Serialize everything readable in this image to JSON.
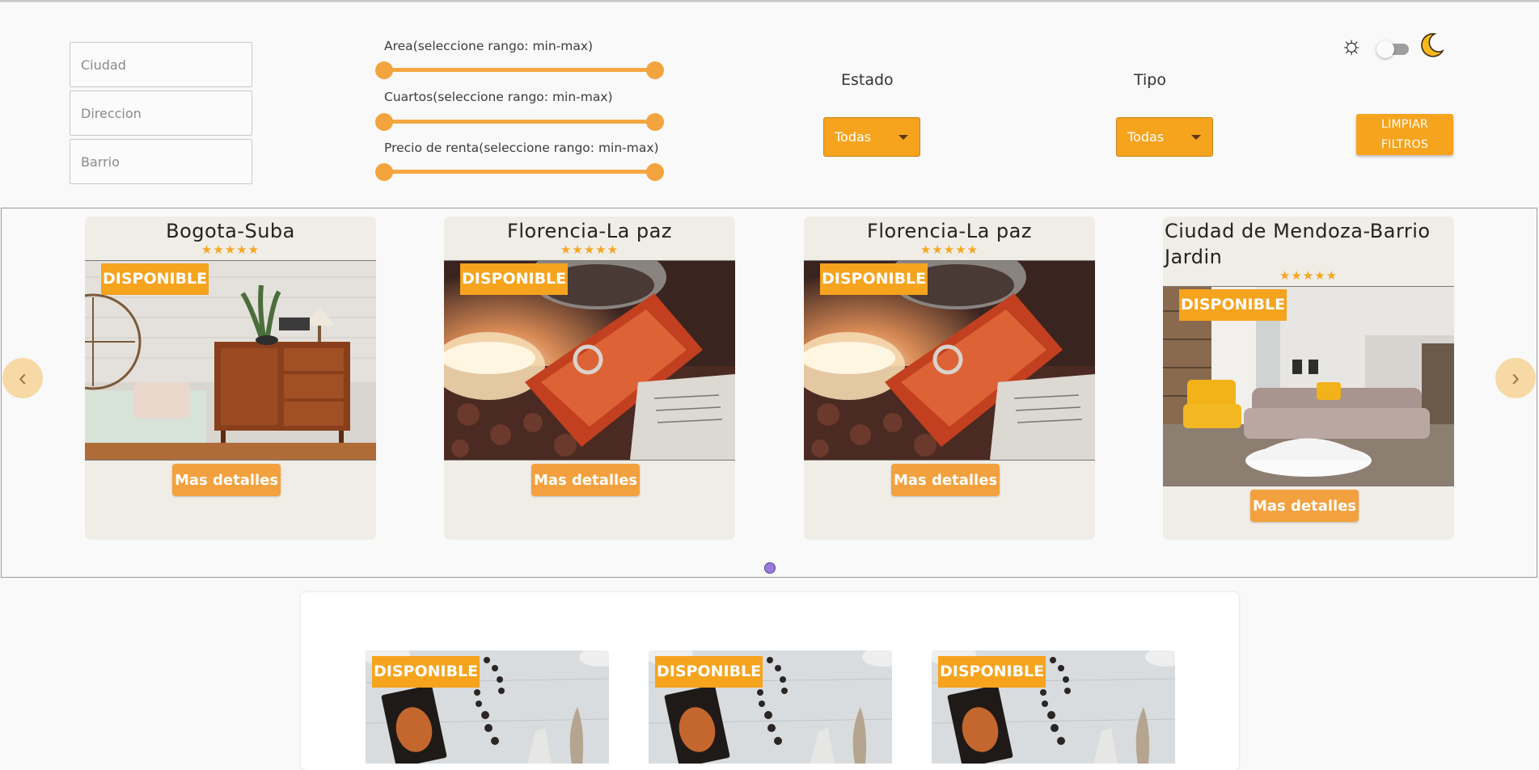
{
  "filters": {
    "inputs": [
      {
        "placeholder": "Ciudad"
      },
      {
        "placeholder": "Direccion"
      },
      {
        "placeholder": "Barrio"
      }
    ],
    "sliders": [
      {
        "label": "Area(seleccione rango: min-max)",
        "min_fraction": 0,
        "max_fraction": 1
      },
      {
        "label": "Cuartos(seleccione rango: min-max)",
        "min_fraction": 0,
        "max_fraction": 1
      },
      {
        "label": "Precio de renta(seleccione rango: min-max)",
        "min_fraction": 0,
        "max_fraction": 1
      }
    ],
    "estado": {
      "label": "Estado",
      "value": "Todas"
    },
    "tipo": {
      "label": "Tipo",
      "value": "Todas"
    },
    "clear_button": "LIMPIAR FILTROS"
  },
  "theme_toggle": {
    "sun_icon": "sun-icon",
    "moon_icon": "moon-icon",
    "dark_mode": false
  },
  "carousel": {
    "prev_label": "‹",
    "next_label": "›",
    "cards": [
      {
        "title": "Bogota-Suba",
        "stars": "★★★★★",
        "badge": "DISPONIBLE",
        "button": "Mas detalles",
        "image": "bedroom-photo"
      },
      {
        "title": "Florencia-La paz",
        "stars": "★★★★★",
        "badge": "DISPONIBLE",
        "button": "Mas detalles",
        "image": "candle-photo"
      },
      {
        "title": "Florencia-La paz",
        "stars": "★★★★★",
        "badge": "DISPONIBLE",
        "button": "Mas detalles",
        "image": "candle-photo"
      },
      {
        "title": "Ciudad de Mendoza-Barrio Jardin",
        "stars": "★★★★★",
        "badge": "DISPONIBLE",
        "button": "Mas detalles",
        "image": "living-room-photo"
      }
    ],
    "colors": {
      "accent": "#f6a31e",
      "card_bg": "#f0ede6",
      "star": "#f5a623"
    }
  },
  "listing": {
    "cards": [
      {
        "badge": "DISPONIBLE",
        "image": "buddha-beads-photo"
      },
      {
        "badge": "DISPONIBLE",
        "image": "buddha-beads-photo"
      },
      {
        "badge": "DISPONIBLE",
        "image": "buddha-beads-photo"
      }
    ]
  }
}
